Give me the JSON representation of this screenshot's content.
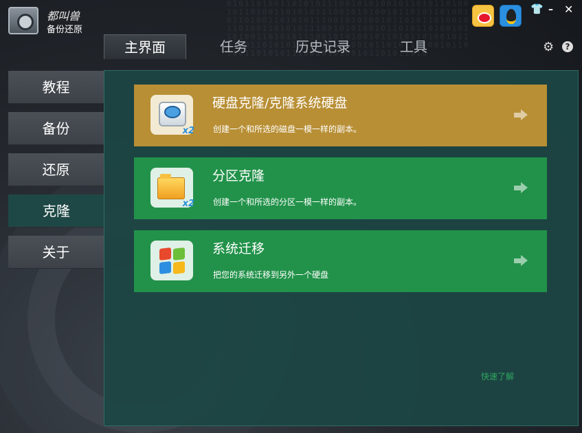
{
  "app": {
    "brand": "都叫兽",
    "subtitle": "备份还原"
  },
  "tabs": [
    {
      "label": "主界面",
      "active": true
    },
    {
      "label": "任务",
      "active": false
    },
    {
      "label": "历史记录",
      "active": false
    },
    {
      "label": "工具",
      "active": false
    }
  ],
  "sidebar": {
    "items": [
      {
        "label": "教程",
        "active": false
      },
      {
        "label": "备份",
        "active": false
      },
      {
        "label": "还原",
        "active": false
      },
      {
        "label": "克隆",
        "active": true
      },
      {
        "label": "关于",
        "active": false
      }
    ]
  },
  "cards": [
    {
      "title": "硬盘克隆/克隆系统硬盘",
      "desc": "创建一个和所选的磁盘一模一样的副本。",
      "icon": "disk-clone-icon",
      "badge": "x2",
      "color": "#b88f35"
    },
    {
      "title": "分区克隆",
      "desc": "创建一个和所选的分区一模一样的副本。",
      "icon": "folder-clone-icon",
      "badge": "x2",
      "color": "#22924a"
    },
    {
      "title": "系统迁移",
      "desc": "把您的系统迁移到另外一个硬盘",
      "icon": "windows-logo-icon",
      "badge": "",
      "color": "#22924a"
    }
  ],
  "quick_link": "快速了解",
  "controls": {
    "help": "?",
    "minimize": "–",
    "close": "✕",
    "skin": "👕",
    "gear": "⚙"
  },
  "colors": {
    "accent": "#22924a",
    "highlight": "#b88f35",
    "panel": "#1c4644"
  }
}
